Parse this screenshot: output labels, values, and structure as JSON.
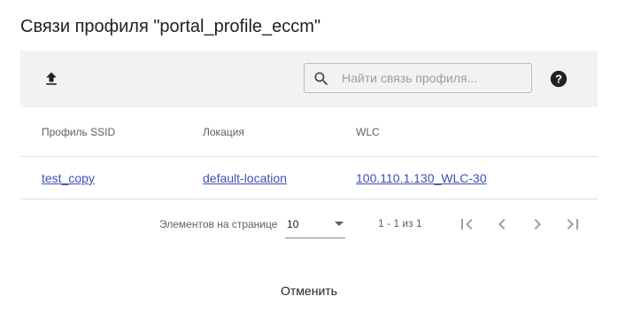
{
  "dialog": {
    "title": "Связи профиля \"portal_profile_eccm\""
  },
  "toolbar": {
    "upload_icon": "upload-icon",
    "search": {
      "placeholder": "Найти связь профиля...",
      "value": ""
    },
    "help_icon": "help-circle-icon"
  },
  "table": {
    "columns": [
      "Профиль SSID",
      "Локация",
      "WLC"
    ],
    "rows": [
      {
        "ssid_profile": "test_copy",
        "location": "default-location",
        "wlc": "100.110.1.130_WLC-30"
      }
    ]
  },
  "paginator": {
    "page_size_label": "Элементов на странице",
    "page_size": "10",
    "range_label": "1 - 1 из 1"
  },
  "actions": {
    "cancel_label": "Отменить"
  },
  "colors": {
    "link": "#3f51b5",
    "toolbar_bg": "#f2f2f2",
    "divider": "#e0e0e0"
  }
}
